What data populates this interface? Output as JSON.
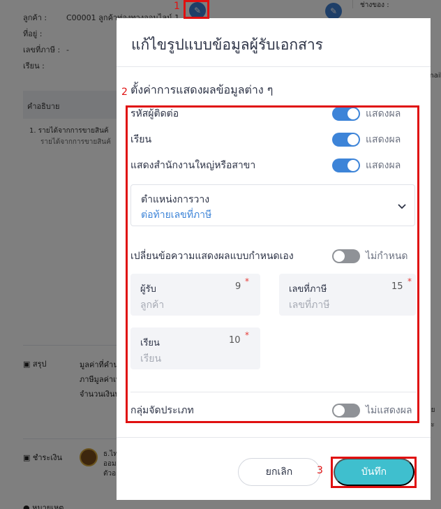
{
  "background": {
    "info_rows": [
      {
        "label": "ลูกค้า :",
        "value": "C00001 ลูกค้าท่องทางออนไลน์ 1"
      },
      {
        "label": "ที่อยู่ :",
        "value": ""
      },
      {
        "label": "เลขที่ภาษี :",
        "value": "-"
      },
      {
        "label": "เรียน :",
        "value": ""
      }
    ],
    "right_top_text": "ช่างของ :",
    "right_email_text": "mail",
    "right_tail_1": "าย",
    "right_tail_2": "ระ",
    "description_header": "คำอธิบาย",
    "description_item": "1.  รายได้จากการขายสินค้",
    "description_sub": "รายได้จากการขายสินค้",
    "summary_label": "สรุป",
    "summary_lines": [
      "มูลค่าที่คำน",
      "ภาษีมูลค่าเพ",
      "จำนวนเงินท"
    ],
    "payment_label": "ชำระเงิน",
    "payment_lines": [
      "ธ.ไท",
      "ออม",
      "ตัวอ"
    ],
    "note_label": "หมายเหตุ"
  },
  "modal": {
    "title": "แก้ไขรูปแบบข้อมูลผู้รับเอกสาร",
    "section_title": "ตั้งค่าการแสดงผลข้อมูลต่าง ๆ",
    "settings": [
      {
        "label": "รหัสผู้ติดต่อ",
        "state": "on",
        "state_text": "แสดงผล"
      },
      {
        "label": "เรียน",
        "state": "on",
        "state_text": "แสดงผล"
      },
      {
        "label": "แสดงสำนักงานใหญ่หรือสาขา",
        "state": "on",
        "state_text": "แสดงผล"
      }
    ],
    "position_select": {
      "label": "ตำแหน่งการวาง",
      "value": "ต่อท้ายเลขที่ภาษี"
    },
    "custom_text": {
      "label": "เปลี่ยนข้อความแสดงผลแบบกำหนดเอง",
      "state": "off",
      "state_text": "ไม่กำหนด"
    },
    "fields": [
      {
        "label": "ผู้รับ",
        "count": "9",
        "required": "*",
        "placeholder": "ลูกค้า"
      },
      {
        "label": "เลขที่ภาษี",
        "count": "15",
        "required": "*",
        "placeholder": "เลขที่ภาษี"
      },
      {
        "label": "เรียน",
        "count": "10",
        "required": "*",
        "placeholder": "เรียน"
      }
    ],
    "group": {
      "label": "กลุ่มจัดประเภท",
      "state": "off",
      "state_text": "ไม่แสดงผล"
    },
    "cancel_label": "ยกเลิก",
    "save_label": "บันทึก"
  },
  "annotations": {
    "step1": "1",
    "step2": "2",
    "step3": "3"
  },
  "colors": {
    "accent_blue": "#3d84d8",
    "save_teal": "#3fbfce",
    "annotation_red": "#e01010",
    "toggle_off": "#8f9297"
  }
}
